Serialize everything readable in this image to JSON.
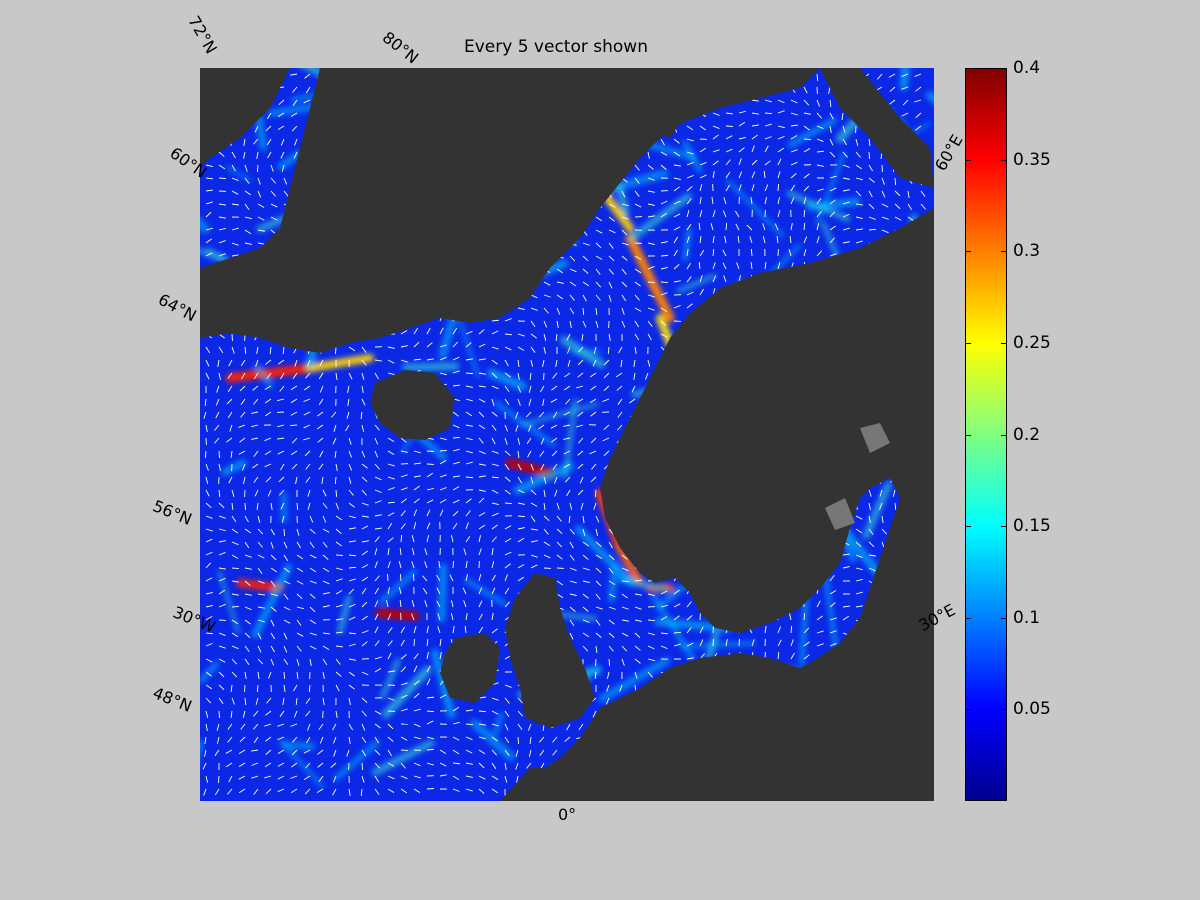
{
  "title": "Every 5 vector shown",
  "map": {
    "type": "ocean current speed with direction vectors",
    "projection": "polar stereographic",
    "land_color": "#333333",
    "lake_color": "#777777",
    "vector_color": "#ffffff",
    "labels": [
      {
        "text": "72°N",
        "kind": "lat"
      },
      {
        "text": "80°N",
        "kind": "lat"
      },
      {
        "text": "60°E",
        "kind": "lon"
      },
      {
        "text": "60°N",
        "kind": "lat"
      },
      {
        "text": "64°N",
        "kind": "lat"
      },
      {
        "text": "56°N",
        "kind": "lat"
      },
      {
        "text": "30°W",
        "kind": "lon"
      },
      {
        "text": "30°E",
        "kind": "lon"
      },
      {
        "text": "48°N",
        "kind": "lat"
      },
      {
        "text": "0°",
        "kind": "lon"
      }
    ]
  },
  "colorbar": {
    "colormap": "jet",
    "min": 0,
    "max": 0.4,
    "ticks": [
      "0.4",
      "0.35",
      "0.3",
      "0.25",
      "0.2",
      "0.15",
      "0.1",
      "0.05"
    ],
    "tick_values": [
      0.4,
      0.35,
      0.3,
      0.25,
      0.2,
      0.15,
      0.1,
      0.05
    ],
    "colors": [
      "#00008f",
      "#0000ff",
      "#0080ff",
      "#00ffff",
      "#80ff80",
      "#ffff00",
      "#ff8000",
      "#ff0000",
      "#800000"
    ]
  }
}
